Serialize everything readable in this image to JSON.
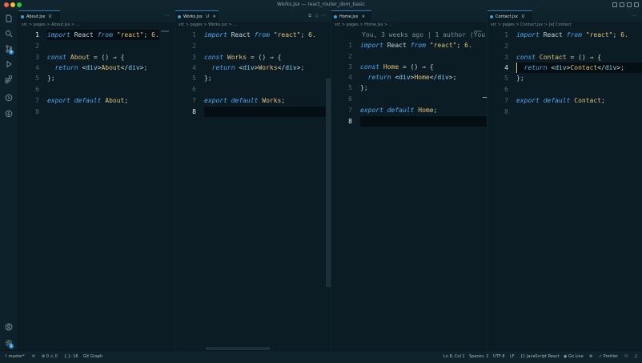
{
  "window": {
    "title": "Works.jsx — react_router_dom_basic"
  },
  "activity_bar": {
    "items": [
      {
        "icon": "files-icon"
      },
      {
        "icon": "search-icon"
      },
      {
        "icon": "source-control-icon",
        "badge": "6"
      },
      {
        "icon": "run-debug-icon"
      },
      {
        "icon": "extensions-icon"
      },
      {
        "icon": "remote-icon"
      },
      {
        "icon": "thunder-icon"
      }
    ],
    "bottom": [
      {
        "icon": "account-icon"
      },
      {
        "icon": "settings-gear-icon",
        "badge": "1"
      }
    ]
  },
  "editors": [
    {
      "tab": {
        "label": "About.jsx",
        "suffix": "U"
      },
      "breadcrumb": "src > pages > About.jsx > ...",
      "current_line": "1",
      "lines": [
        {
          "n": "1",
          "t": "import React from \"react\"; 6."
        },
        {
          "n": "2",
          "t": ""
        },
        {
          "n": "3",
          "t": "const About = () ⇒ {"
        },
        {
          "n": "4",
          "t": "  return <div>About</div>;"
        },
        {
          "n": "5",
          "t": "};"
        },
        {
          "n": "6",
          "t": ""
        },
        {
          "n": "7",
          "t": "export default About;"
        },
        {
          "n": "8",
          "t": ""
        }
      ]
    },
    {
      "tab": {
        "label": "Works.jsx",
        "suffix": "U"
      },
      "breadcrumb": "src > pages > Works.jsx > ...",
      "current_line": "8",
      "lines": [
        {
          "n": "1",
          "t": "import React from \"react\"; 6."
        },
        {
          "n": "2",
          "t": ""
        },
        {
          "n": "3",
          "t": "const Works = () ⇒ {"
        },
        {
          "n": "4",
          "t": "  return <div>Works</div>;"
        },
        {
          "n": "5",
          "t": "};"
        },
        {
          "n": "6",
          "t": ""
        },
        {
          "n": "7",
          "t": "export default Works;"
        },
        {
          "n": "8",
          "t": ""
        }
      ]
    },
    {
      "tab": {
        "label": "Home.jsx"
      },
      "breadcrumb": "src > pages > Home.jsx > ...",
      "blame": "You, 3 weeks ago | 1 author (You",
      "current_line": "8",
      "lines": [
        {
          "n": "1",
          "t": "import React from \"react\"; 6."
        },
        {
          "n": "2",
          "t": ""
        },
        {
          "n": "3",
          "t": "const Home = () ⇒ {"
        },
        {
          "n": "4",
          "t": "  return <div>Home</div>;"
        },
        {
          "n": "5",
          "t": "};"
        },
        {
          "n": "6",
          "t": ""
        },
        {
          "n": "7",
          "t": "export default Home;"
        },
        {
          "n": "8",
          "t": ""
        }
      ]
    },
    {
      "tab": {
        "label": "Contact.jsx",
        "suffix": "U"
      },
      "breadcrumb": "src > pages > Contact.jsx > [e] Contact",
      "current_line": "4",
      "lines": [
        {
          "n": "1",
          "t": "import React from \"react\"; 6."
        },
        {
          "n": "2",
          "t": ""
        },
        {
          "n": "3",
          "t": "const Contact = () ⇒ {"
        },
        {
          "n": "4",
          "t": "  return <div>Contact</div>;"
        },
        {
          "n": "5",
          "t": "};"
        },
        {
          "n": "6",
          "t": ""
        },
        {
          "n": "7",
          "t": "export default Contact;"
        },
        {
          "n": "8",
          "t": ""
        }
      ]
    }
  ],
  "status_bar": {
    "branch": "master*",
    "problems": "⊗ 0 ⚠ 0",
    "braces": "{.}: 16",
    "git_graph": "Git Graph",
    "position": "Ln 8, Col 1",
    "spaces": "Spaces: 2",
    "encoding": "UTF-8",
    "eol": "LF",
    "language": "{} JavaScript React",
    "go_live": "Go Live",
    "prettier": "Prettier"
  }
}
